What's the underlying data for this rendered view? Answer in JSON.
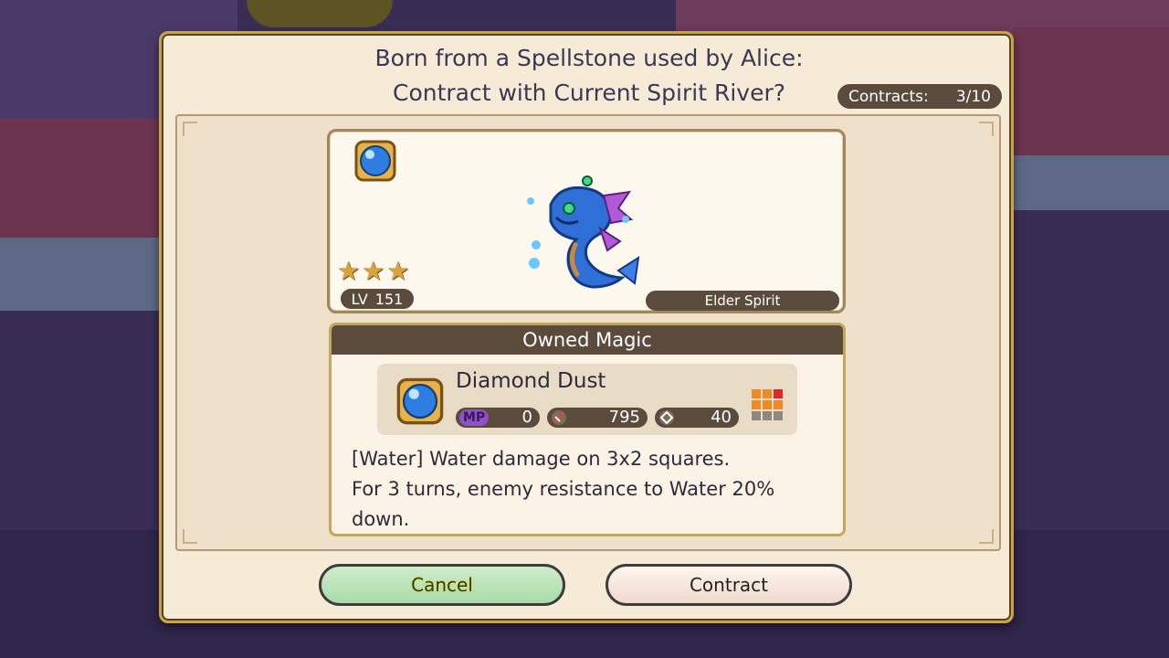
{
  "dialog": {
    "title_line1": "Born from a Spellstone used by Alice:",
    "title_line2": "Contract with Current Spirit River?",
    "contracts_label": "Contracts:",
    "contracts_value": "3/10"
  },
  "spirit": {
    "element_icon": "water-orb-icon",
    "stars": 3,
    "level_label": "LV",
    "level_value": "151",
    "rank": "Elder Spirit"
  },
  "magic": {
    "section_title": "Owned Magic",
    "name": "Diamond Dust",
    "mp_label": "MP",
    "mp_value": "0",
    "power_value": "795",
    "range_value": "40",
    "description_line1": "[Water] Water damage on 3x2 squares.",
    "description_line2": "For 3 turns, enemy resistance to Water 20%",
    "description_line3": "down."
  },
  "buttons": {
    "cancel": "Cancel",
    "contract": "Contract"
  },
  "colors": {
    "panel": "#f6ebd6",
    "accent_dark": "#5b4b3d",
    "gold_border": "#c8a24a",
    "mp": "#8d53c2"
  }
}
